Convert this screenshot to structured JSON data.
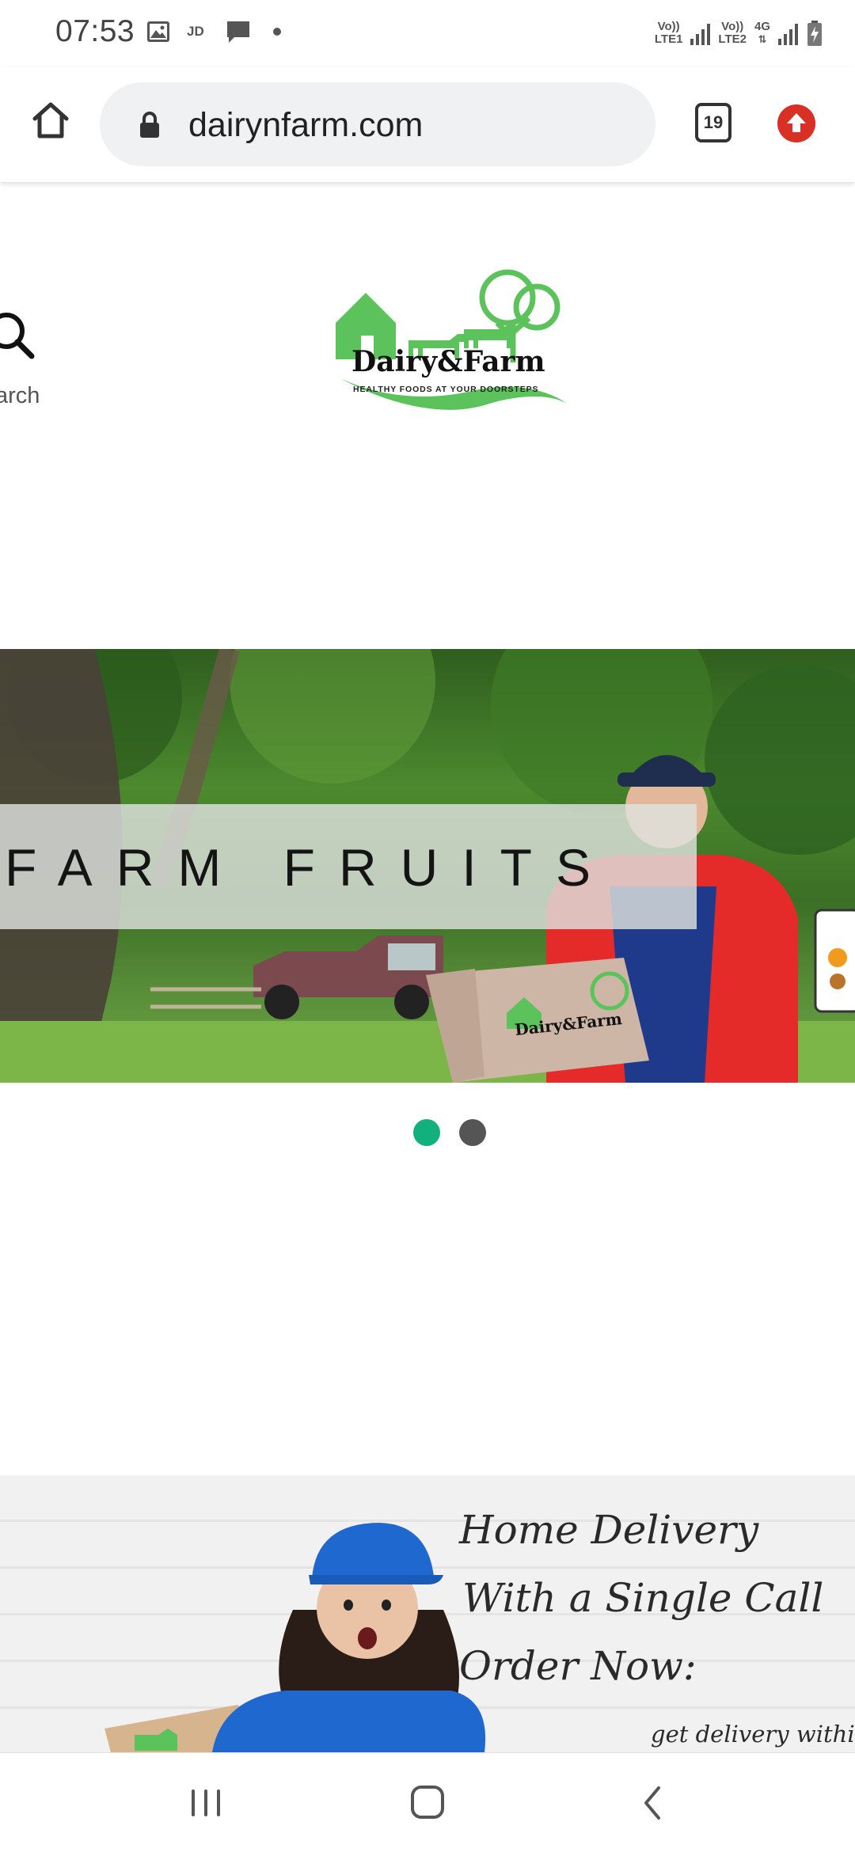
{
  "status_bar": {
    "time": "07:53",
    "notification_icons": [
      "gallery-icon",
      "jd-icon",
      "message-icon",
      "dot-icon"
    ],
    "jd_label": "JD",
    "sim1_label_top": "Vo))",
    "sim1_label_bottom": "LTE1",
    "sim2_label_top": "Vo))",
    "sim2_label_bottom": "LTE2",
    "network_type": "4G",
    "battery_icon": "battery-charging-icon"
  },
  "browser": {
    "home_icon": "home-icon",
    "url": "dairynfarm.com",
    "lock_icon": "lock-icon",
    "tab_count": "19",
    "update_icon": "update-arrow-icon"
  },
  "site_header": {
    "search_label": "arch",
    "logo_title": "Dairy&Farm",
    "logo_tagline": "HEALTHY FOODS AT YOUR DOORSTEPS"
  },
  "hero": {
    "slide_text": "FARM FRUITS",
    "box_logo_title": "Dairy&Farm",
    "slides_total": 2,
    "active_slide": 1
  },
  "delivery_banner": {
    "line1": "Home Delivery",
    "line2": "With a Single Call",
    "line3": "Order Now:",
    "line4": "get delivery within"
  },
  "colors": {
    "accent_green": "#12b07c",
    "logo_green": "#5cc25c",
    "update_red": "#d93025"
  },
  "nav_bar": {
    "icons": [
      "recent-apps-icon",
      "home-nav-icon",
      "back-icon"
    ]
  }
}
